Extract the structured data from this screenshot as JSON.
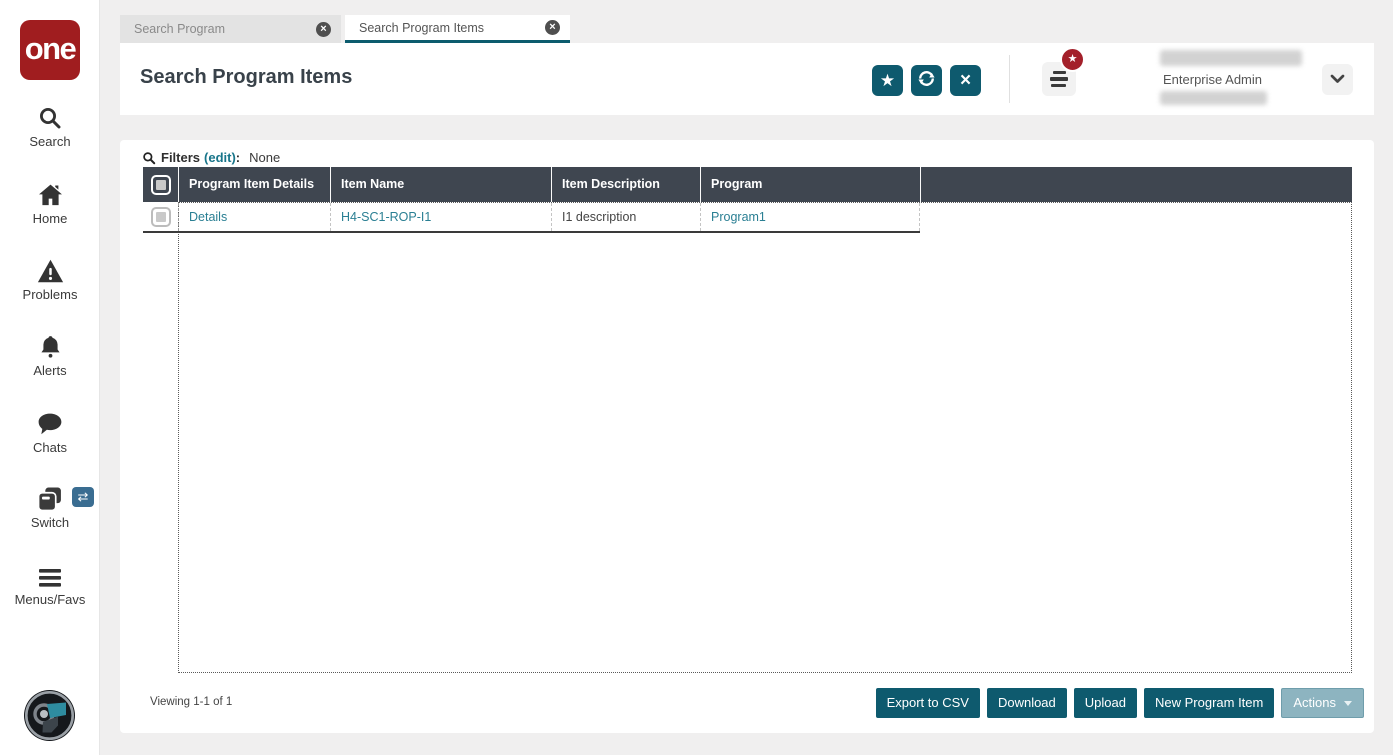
{
  "logo": {
    "text": "one"
  },
  "icons": {
    "star": "★",
    "close_x": "×",
    "tab_close": "×",
    "swap": "⇄",
    "badge_star": "★"
  },
  "sidebar": {
    "items": [
      {
        "label": "Search",
        "icon": "search"
      },
      {
        "label": "Home",
        "icon": "home"
      },
      {
        "label": "Problems",
        "icon": "warning-triangle"
      },
      {
        "label": "Alerts",
        "icon": "bell"
      },
      {
        "label": "Chats",
        "icon": "chat-bubble"
      },
      {
        "label": "Switch",
        "icon": "switch-windows",
        "badge_icon": "swap-arrows"
      },
      {
        "label": "Menus/Favs",
        "icon": "menu"
      }
    ]
  },
  "tabs": [
    {
      "label": "Search Program",
      "active": false
    },
    {
      "label": "Search Program Items",
      "active": true
    }
  ],
  "header": {
    "title": "Search Program Items",
    "user": {
      "role": "Enterprise Admin"
    }
  },
  "filters": {
    "label": "Filters",
    "edit": "(edit)",
    "separator": ":",
    "value": "None"
  },
  "table": {
    "columns": [
      "Program Item Details",
      "Item Name",
      "Item Description",
      "Program"
    ],
    "rows": [
      {
        "details_link": "Details",
        "item_name": "H4-SC1-ROP-I1",
        "item_description": "I1 description",
        "program": "Program1"
      }
    ]
  },
  "footer": {
    "viewing": "Viewing 1-1 of 1",
    "export_csv": "Export to CSV",
    "download": "Download",
    "upload": "Upload",
    "new_program_item": "New Program Item",
    "actions": "Actions"
  },
  "colors": {
    "teal_button": "#0e5a6e",
    "table_header": "#3f4650",
    "link_teal": "#2a7f93",
    "tab_underline": "#0c5c6e",
    "logo_red": "#a01d1f",
    "badge_red": "#a3202a",
    "actions_muted": "#8db4c0",
    "switch_badge_blue": "#3a6d91",
    "page_background": "#f0efef"
  }
}
